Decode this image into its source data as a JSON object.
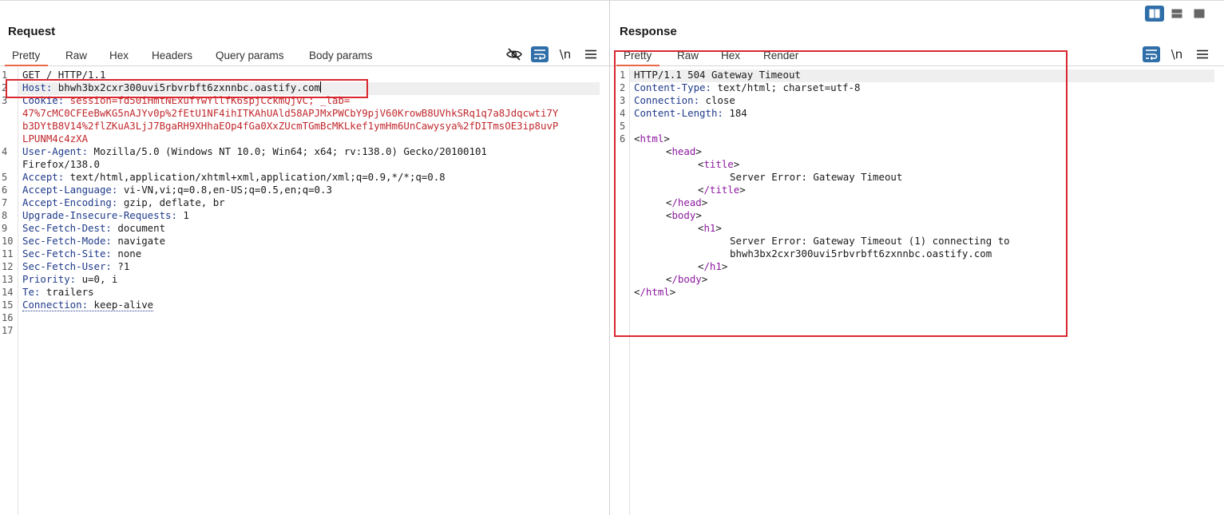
{
  "request": {
    "title": "Request",
    "tabs": [
      "Pretty",
      "Raw",
      "Hex",
      "Headers",
      "Query params",
      "Body params"
    ],
    "line_numbers": [
      "1",
      "2",
      "3",
      "4",
      "5",
      "6",
      "7",
      "8",
      "9",
      "10",
      "11",
      "12",
      "13",
      "14",
      "15",
      "16",
      "17"
    ],
    "line1": "GET / HTTP/1.1",
    "host_key": "Host:",
    "host_val": " bhwh3bx2cxr300uvi5rbvrbft6zxnnbc.oastify.com",
    "cookie_key": "Cookie:",
    "cookie_lines": [
      " session=fd50iHmtNExufYwYllfK6spjCckmQjvC; _lab=",
      "47%7cMC0CFEeBwKG5nAJYv0p%2fEtU1NF4ihITKAhUAld58APJMxPWCbY9pjV60KrowB8UVhkSRq1q7a8Jdqcwti7Y",
      "b3DYtB8V14%2flZKuA3LjJ7BgaRH9XHhaEOp4fGa0XxZUcmTGmBcMKLkef1ymHm6UnCawysya%2fDITmsOE3ip8uvP",
      "LPUNM4c4zXA"
    ],
    "ua_key": "User-Agent:",
    "ua_val": " Mozilla/5.0 (Windows NT 10.0; Win64; x64; rv:138.0) Gecko/20100101",
    "ua_val2": "Firefox/138.0",
    "headers": [
      {
        "k": "Accept:",
        "v": " text/html,application/xhtml+xml,application/xml;q=0.9,*/*;q=0.8"
      },
      {
        "k": "Accept-Language:",
        "v": " vi-VN,vi;q=0.8,en-US;q=0.5,en;q=0.3"
      },
      {
        "k": "Accept-Encoding:",
        "v": " gzip, deflate, br"
      },
      {
        "k": "Upgrade-Insecure-Requests:",
        "v": " 1"
      },
      {
        "k": "Sec-Fetch-Dest:",
        "v": " document"
      },
      {
        "k": "Sec-Fetch-Mode:",
        "v": " navigate"
      },
      {
        "k": "Sec-Fetch-Site:",
        "v": " none"
      },
      {
        "k": "Sec-Fetch-User:",
        "v": " ?1"
      },
      {
        "k": "Priority:",
        "v": " u=0, i"
      },
      {
        "k": "Te:",
        "v": " trailers"
      }
    ],
    "conn_key": "Connection:",
    "conn_val": " keep-alive"
  },
  "response": {
    "title": "Response",
    "tabs": [
      "Pretty",
      "Raw",
      "Hex",
      "Render"
    ],
    "line_numbers": [
      "1",
      "2",
      "3",
      "4",
      "5",
      "6"
    ],
    "status_line": "HTTP/1.1 504 Gateway Timeout",
    "headers": [
      {
        "k": "Content-Type:",
        "v": " text/html; charset=utf-8"
      },
      {
        "k": "Connection:",
        "v": " close"
      },
      {
        "k": "Content-Length:",
        "v": " 184"
      }
    ],
    "tags": {
      "html_open": "html",
      "head_open": "head",
      "title_open": "title",
      "title_close": "/title",
      "head_close": "/head",
      "body_open": "body",
      "h1_open": "h1",
      "h1_close": "/h1",
      "body_close": "/body",
      "html_close": "/html"
    },
    "lt": "<",
    "gt": ">",
    "title_text": "Server Error: Gateway Timeout",
    "h1_text_1": "Server Error: Gateway Timeout (1) connecting to",
    "h1_text_2": "bhwh3bx2cxr300uvi5rbvrbft6zxnnbc.oastify.com"
  },
  "toolbar_icons": {
    "hide": "eye-slash-icon",
    "wrap": "word-wrap-icon",
    "newline": "\\n",
    "menu": "hamburger-menu-icon"
  },
  "layout_buttons": [
    "side-by-side-icon",
    "stacked-icon",
    "single-pane-icon"
  ],
  "colors": {
    "accent": "#e8684a",
    "blue": "#2f6ea8",
    "key": "#1f3a8a",
    "cookie": "#c0282d",
    "tag": "#8b1a9e",
    "highlight": "#d9282f"
  }
}
